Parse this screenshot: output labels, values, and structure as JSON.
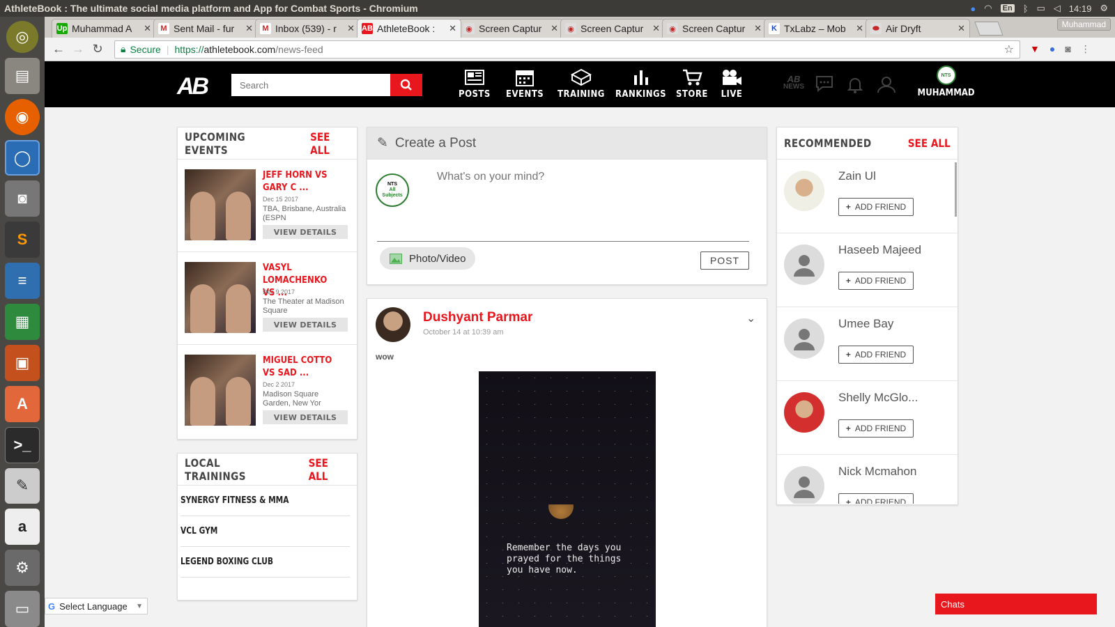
{
  "os": {
    "window_title": "AthleteBook : The ultimate social media platform and App for Combat Sports - Chromium",
    "lang": "En",
    "time": "14:19"
  },
  "browser": {
    "tabs": [
      {
        "label": "Muhammad A",
        "fav": "Up",
        "color": "#14a800"
      },
      {
        "label": "Sent Mail - fur",
        "fav": "M",
        "color": "#ffffff"
      },
      {
        "label": "Inbox (539) - r",
        "fav": "M",
        "color": "#ffffff"
      },
      {
        "label": "AthleteBook :",
        "fav": "AB",
        "color": "#e8161d"
      },
      {
        "label": "Screen Captur",
        "fav": "◉",
        "color": "#dddddd"
      },
      {
        "label": "Screen Captur",
        "fav": "◉",
        "color": "#dddddd"
      },
      {
        "label": "Screen Captur",
        "fav": "◉",
        "color": "#dddddd"
      },
      {
        "label": "TxLabz – Mob",
        "fav": "K",
        "color": "#ffffff"
      },
      {
        "label": "Air Dryft",
        "fav": "⬬",
        "color": "#dddddd"
      }
    ],
    "profile": "Muhammad",
    "address": {
      "secure": "Secure",
      "proto": "https://",
      "host": "athletebook.com",
      "path": "/news-feed"
    }
  },
  "site": {
    "search_placeholder": "Search",
    "nav": [
      "POSTS",
      "EVENTS",
      "TRAINING",
      "RANKINGS",
      "STORE",
      "LIVE"
    ],
    "news_label": "NEWS",
    "user": "MUHAMMAD",
    "avatar_text": "NTS"
  },
  "events": {
    "title": "UPCOMING EVENTS",
    "see_all": "SEE ALL",
    "items": [
      {
        "title": "JEFF HORN VS GARY C ...",
        "date": "Dec 15 2017",
        "location": "TBA, Brisbane, Australia (ESPN",
        "button": "VIEW DETAILS"
      },
      {
        "title": "VASYL LOMACHENKO VS ...",
        "date": "Dec 9 2017",
        "location": "The Theater at Madison Square",
        "button": "VIEW DETAILS"
      },
      {
        "title": "MIGUEL COTTO VS SAD ...",
        "date": "Dec 2 2017",
        "location": "Madison Square Garden, New Yor",
        "button": "VIEW DETAILS"
      }
    ]
  },
  "trainings": {
    "title": "LOCAL TRAININGS",
    "see_all": "SEE ALL",
    "items": [
      "SYNERGY FITNESS & MMA",
      "VCL GYM",
      "LEGEND BOXING CLUB"
    ]
  },
  "create_post": {
    "title": "Create a Post",
    "placeholder": "What's on your mind?",
    "avatar_lines": [
      "NTS",
      "All",
      "Subjects"
    ],
    "photo_video": "Photo/Video",
    "post": "POST"
  },
  "feed_post": {
    "author": "Dushyant Parmar",
    "time": "October 14 at 10:39 am",
    "text": "wow",
    "image_caption": "Remember the days you prayed for the things you have now."
  },
  "recommended": {
    "title": "RECOMMENDED",
    "see_all": "SEE ALL",
    "add_label": "ADD FRIEND",
    "items": [
      {
        "name": "Zain Ul",
        "photo": true
      },
      {
        "name": "Haseeb Majeed",
        "photo": false
      },
      {
        "name": "Umee Bay",
        "photo": false
      },
      {
        "name": "Shelly McGlo...",
        "photo": true
      },
      {
        "name": "Nick Mcmahon",
        "photo": false
      }
    ]
  },
  "footer": {
    "select_language": "Select Language",
    "chats": "Chats"
  }
}
